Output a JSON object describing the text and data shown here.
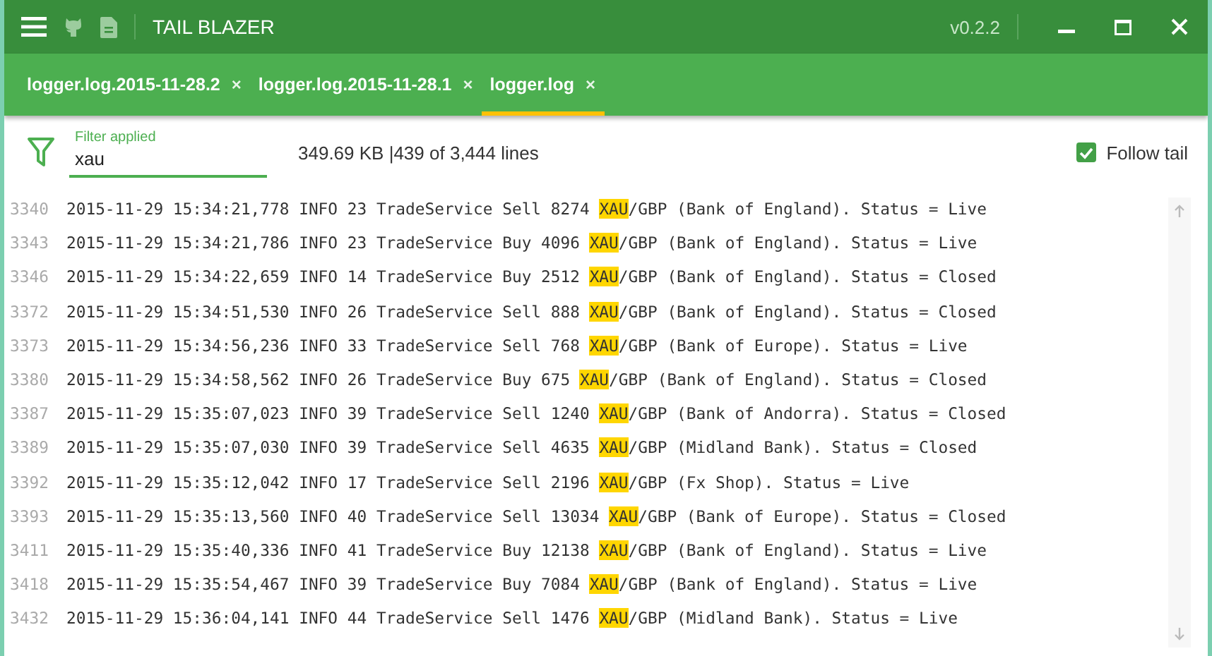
{
  "window": {
    "title": "TAIL BLAZER",
    "version": "v0.2.2"
  },
  "tabs": [
    {
      "label": "logger.log.2015-11-28.2",
      "close": "×",
      "selected": false
    },
    {
      "label": "logger.log.2015-11-28.1",
      "close": "×",
      "selected": false
    },
    {
      "label": "logger.log",
      "close": "×",
      "selected": true
    }
  ],
  "filter": {
    "label": "Filter applied",
    "value": "xau",
    "summary": "349.69 KB |439 of 3,444 lines"
  },
  "follow_tail": {
    "label": "Follow tail",
    "checked": true
  },
  "lines": [
    {
      "number": "3340",
      "before": "2015-11-29 15:34:21,778 INFO 23 TradeService Sell 8274 ",
      "match": "XAU",
      "after": "/GBP (Bank of England). Status = Live"
    },
    {
      "number": "3343",
      "before": "2015-11-29 15:34:21,786 INFO 23 TradeService Buy 4096 ",
      "match": "XAU",
      "after": "/GBP (Bank of England). Status = Live"
    },
    {
      "number": "3346",
      "before": "2015-11-29 15:34:22,659 INFO 14 TradeService Buy 2512 ",
      "match": "XAU",
      "after": "/GBP (Bank of England). Status = Closed"
    },
    {
      "number": "3372",
      "before": "2015-11-29 15:34:51,530 INFO 26 TradeService Sell 888 ",
      "match": "XAU",
      "after": "/GBP (Bank of England). Status = Closed"
    },
    {
      "number": "3373",
      "before": "2015-11-29 15:34:56,236 INFO 33 TradeService Sell 768 ",
      "match": "XAU",
      "after": "/GBP (Bank of Europe). Status = Live"
    },
    {
      "number": "3380",
      "before": "2015-11-29 15:34:58,562 INFO 26 TradeService Buy 675 ",
      "match": "XAU",
      "after": "/GBP (Bank of England). Status = Closed"
    },
    {
      "number": "3387",
      "before": "2015-11-29 15:35:07,023 INFO 39 TradeService Sell 1240 ",
      "match": "XAU",
      "after": "/GBP (Bank of Andorra). Status = Closed"
    },
    {
      "number": "3389",
      "before": "2015-11-29 15:35:07,030 INFO 39 TradeService Sell 4635 ",
      "match": "XAU",
      "after": "/GBP (Midland Bank). Status = Closed"
    },
    {
      "number": "3392",
      "before": "2015-11-29 15:35:12,042 INFO 17 TradeService Sell 2196 ",
      "match": "XAU",
      "after": "/GBP (Fx Shop). Status = Live"
    },
    {
      "number": "3393",
      "before": "2015-11-29 15:35:13,560 INFO 40 TradeService Sell 13034 ",
      "match": "XAU",
      "after": "/GBP (Bank of Europe). Status = Closed"
    },
    {
      "number": "3411",
      "before": "2015-11-29 15:35:40,336 INFO 41 TradeService Buy 12138 ",
      "match": "XAU",
      "after": "/GBP (Bank of England). Status = Live"
    },
    {
      "number": "3418",
      "before": "2015-11-29 15:35:54,467 INFO 39 TradeService Buy 7084 ",
      "match": "XAU",
      "after": "/GBP (Bank of England). Status = Live"
    },
    {
      "number": "3432",
      "before": "2015-11-29 15:36:04,141 INFO 44 TradeService Sell 1476 ",
      "match": "XAU",
      "after": "/GBP (Midland Bank). Status = Live"
    }
  ]
}
